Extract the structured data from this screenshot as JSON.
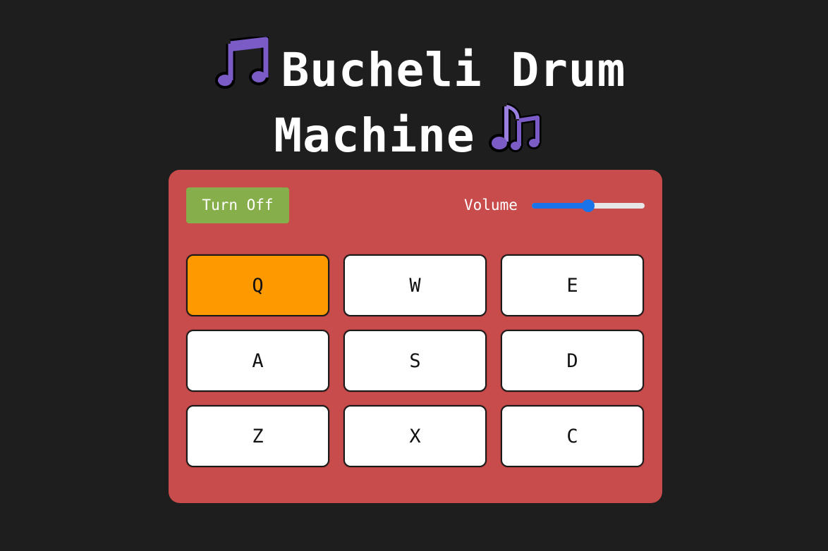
{
  "title": {
    "line1": "Bucheli Drum",
    "line2": "Machine",
    "icon_left": "musical-note-icon",
    "icon_right": "musical-notes-icon",
    "icon_color": "#7b5cc7"
  },
  "controls": {
    "power_label": "Turn Off",
    "volume_label": "Volume",
    "volume_value": 0.5
  },
  "pads": [
    {
      "key": "Q",
      "active": true
    },
    {
      "key": "W",
      "active": false
    },
    {
      "key": "E",
      "active": false
    },
    {
      "key": "A",
      "active": false
    },
    {
      "key": "S",
      "active": false
    },
    {
      "key": "D",
      "active": false
    },
    {
      "key": "Z",
      "active": false
    },
    {
      "key": "X",
      "active": false
    },
    {
      "key": "C",
      "active": false
    }
  ],
  "colors": {
    "background": "#1e1e1e",
    "panel": "#c94c4c",
    "power_button": "#86ae4a",
    "active_pad": "#ff9900",
    "slider_accent": "#1a73e8"
  }
}
